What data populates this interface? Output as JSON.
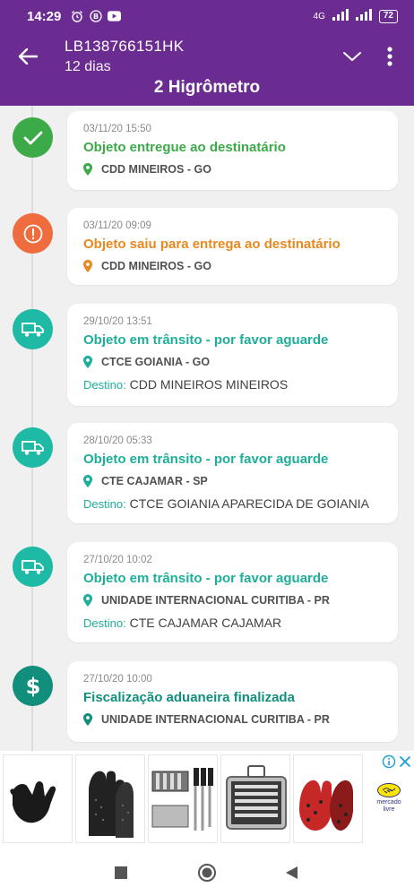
{
  "status_bar": {
    "time": "14:29",
    "network": "4G",
    "battery": "72"
  },
  "header": {
    "tracking_code": "LB138766151HK",
    "days": "12 dias",
    "item_name": "2 Higrômetro"
  },
  "colors": {
    "purple": "#6b2c91",
    "green": "#3daa4a",
    "orange": "#ef6c3e",
    "orange_text": "#e8891f",
    "teal": "#1fbaa6",
    "teal_dark": "#128f7c"
  },
  "events": [
    {
      "date": "03/11/20 15:50",
      "title": "Objeto entregue ao destinatário",
      "location": "CDD MINEIROS - GO",
      "icon": "check-icon"
    },
    {
      "date": "03/11/20 09:09",
      "title": "Objeto saiu para entrega ao destinatário",
      "location": "CDD MINEIROS - GO",
      "icon": "alert-icon"
    },
    {
      "date": "29/10/20 13:51",
      "title": "Objeto em trânsito - por favor aguarde",
      "location": "CTCE GOIANIA - GO",
      "dest_label": "Destino:",
      "destination": "CDD MINEIROS MINEIROS",
      "icon": "truck-icon"
    },
    {
      "date": "28/10/20 05:33",
      "title": "Objeto em trânsito - por favor aguarde",
      "location": "CTE CAJAMAR - SP",
      "dest_label": "Destino:",
      "destination": "CTCE GOIANIA APARECIDA DE GOIANIA",
      "icon": "truck-icon"
    },
    {
      "date": "27/10/20 10:02",
      "title": "Objeto em trânsito - por favor aguarde",
      "location": "UNIDADE INTERNACIONAL CURITIBA - PR",
      "dest_label": "Destino:",
      "destination": "CTE CAJAMAR CAJAMAR",
      "icon": "truck-icon"
    },
    {
      "date": "27/10/20 10:00",
      "title": "Fiscalização aduaneira finalizada",
      "location": "UNIDADE INTERNACIONAL CURITIBA - PR",
      "icon": "dollar-icon"
    }
  ],
  "ad": {
    "brand_line1": "mercado",
    "brand_line2": "livre"
  }
}
